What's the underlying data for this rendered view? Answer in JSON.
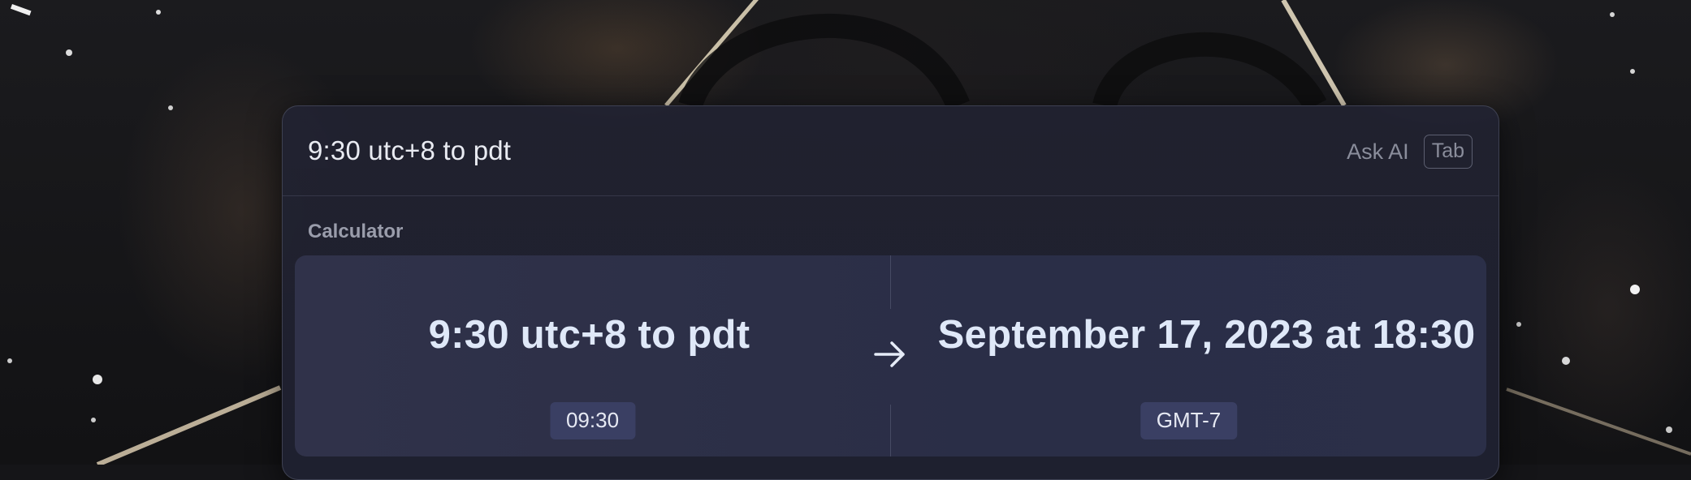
{
  "search": {
    "query": "9:30 utc+8 to pdt",
    "ask_ai_label": "Ask AI",
    "tab_key": "Tab"
  },
  "results": {
    "section_label": "Calculator",
    "calculator": {
      "input_expression": "9:30 utc+8 to pdt",
      "input_caption": "09:30",
      "output_value": "September 17, 2023 at 18:30",
      "output_caption": "GMT-7",
      "arrow_icon": "arrow-right-icon"
    }
  },
  "colors": {
    "window_bg": "#212230",
    "card_bg": "#2c2f47",
    "chip_bg": "#3a3f63",
    "primary_text": "#dfe8f8",
    "muted_text": "#8a8d9b"
  }
}
